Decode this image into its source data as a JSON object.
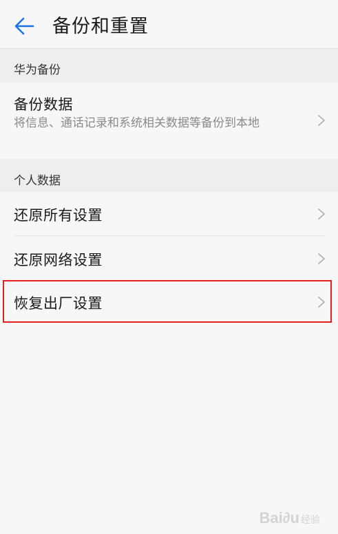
{
  "header": {
    "title": "备份和重置",
    "back_icon": "back-arrow-icon",
    "accent_color": "#1a73e8"
  },
  "sections": [
    {
      "label": "华为备份",
      "items": [
        {
          "title": "备份数据",
          "subtitle": "将信息、通话记录和系统相关数据等备份到本地"
        }
      ]
    },
    {
      "label": "个人数据",
      "items": [
        {
          "title": "还原所有设置"
        },
        {
          "title": "还原网络设置"
        },
        {
          "title": "恢复出厂设置"
        }
      ]
    }
  ],
  "highlight_color": "#e02020",
  "watermark": {
    "brand": "Bai∂u",
    "sub": "经验"
  }
}
